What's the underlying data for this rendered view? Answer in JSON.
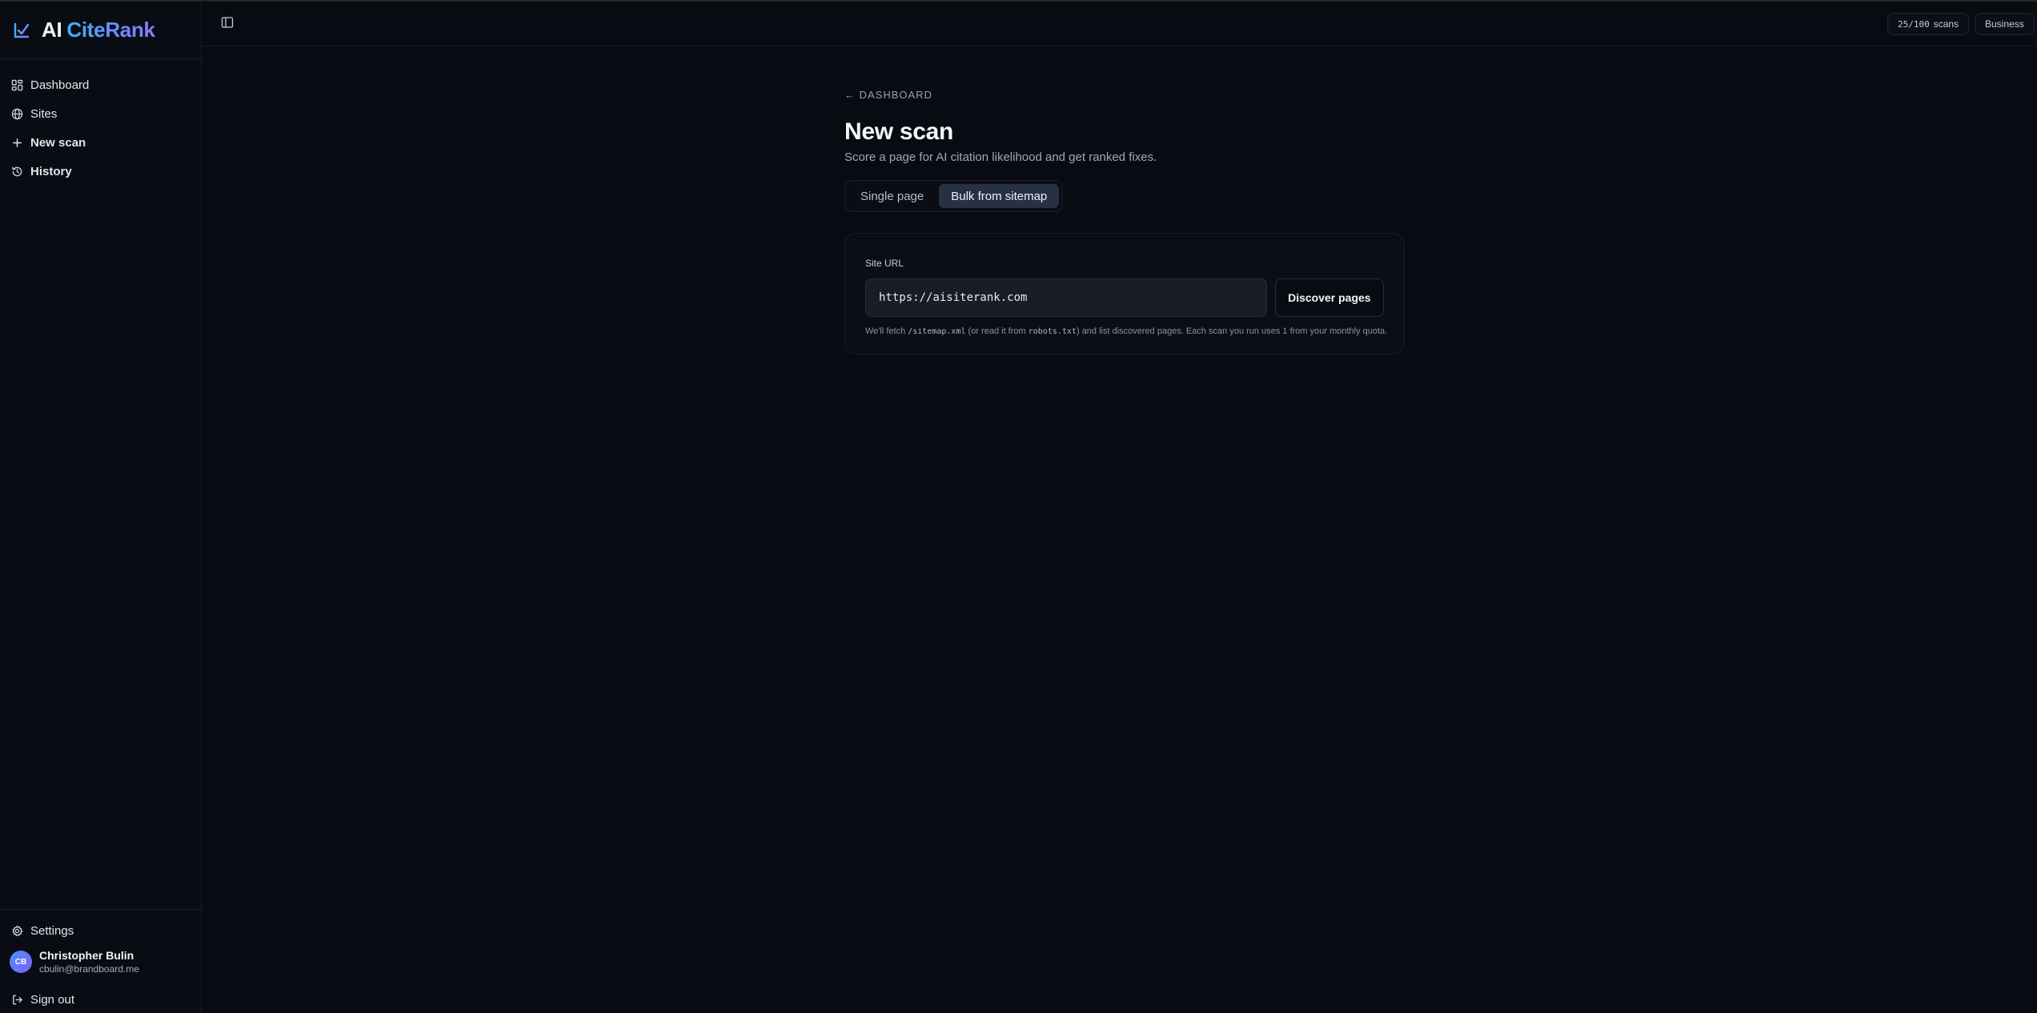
{
  "brand": {
    "prefix": "AI",
    "name": "CiteRank"
  },
  "sidebar": {
    "items": [
      {
        "label": "Dashboard",
        "icon": "dashboard-icon"
      },
      {
        "label": "Sites",
        "icon": "globe-icon"
      },
      {
        "label": "New scan",
        "icon": "plus-icon",
        "active": true
      },
      {
        "label": "History",
        "icon": "history-icon"
      }
    ],
    "settings_label": "Settings",
    "user": {
      "initials": "CB",
      "name": "Christopher Bulin",
      "email": "cbulin@brandboard.me"
    },
    "signout_label": "Sign out"
  },
  "topbar": {
    "quota_count": "25/100",
    "quota_label": "scans",
    "plan": "Business"
  },
  "page": {
    "back_label": "← DASHBOARD",
    "title": "New scan",
    "subtitle": "Score a page for AI citation likelihood and get ranked fixes.",
    "tabs": [
      {
        "label": "Single page",
        "selected": false
      },
      {
        "label": "Bulk from sitemap",
        "selected": true
      }
    ]
  },
  "form": {
    "field_label": "Site URL",
    "url_value": "https://aisiterank.com",
    "button_label": "Discover pages",
    "hint": {
      "p1": "We'll fetch ",
      "code1": "/sitemap.xml",
      "p2": " (or read it from ",
      "code2": "robots.txt",
      "p3": ") and list discovered pages. Each scan you run uses 1 from your monthly quota."
    }
  },
  "colors": {
    "background": "#090b13",
    "selected_tab": "#283044",
    "brand_gradient_start": "#3fb2ff",
    "brand_gradient_end": "#8a7dff"
  }
}
